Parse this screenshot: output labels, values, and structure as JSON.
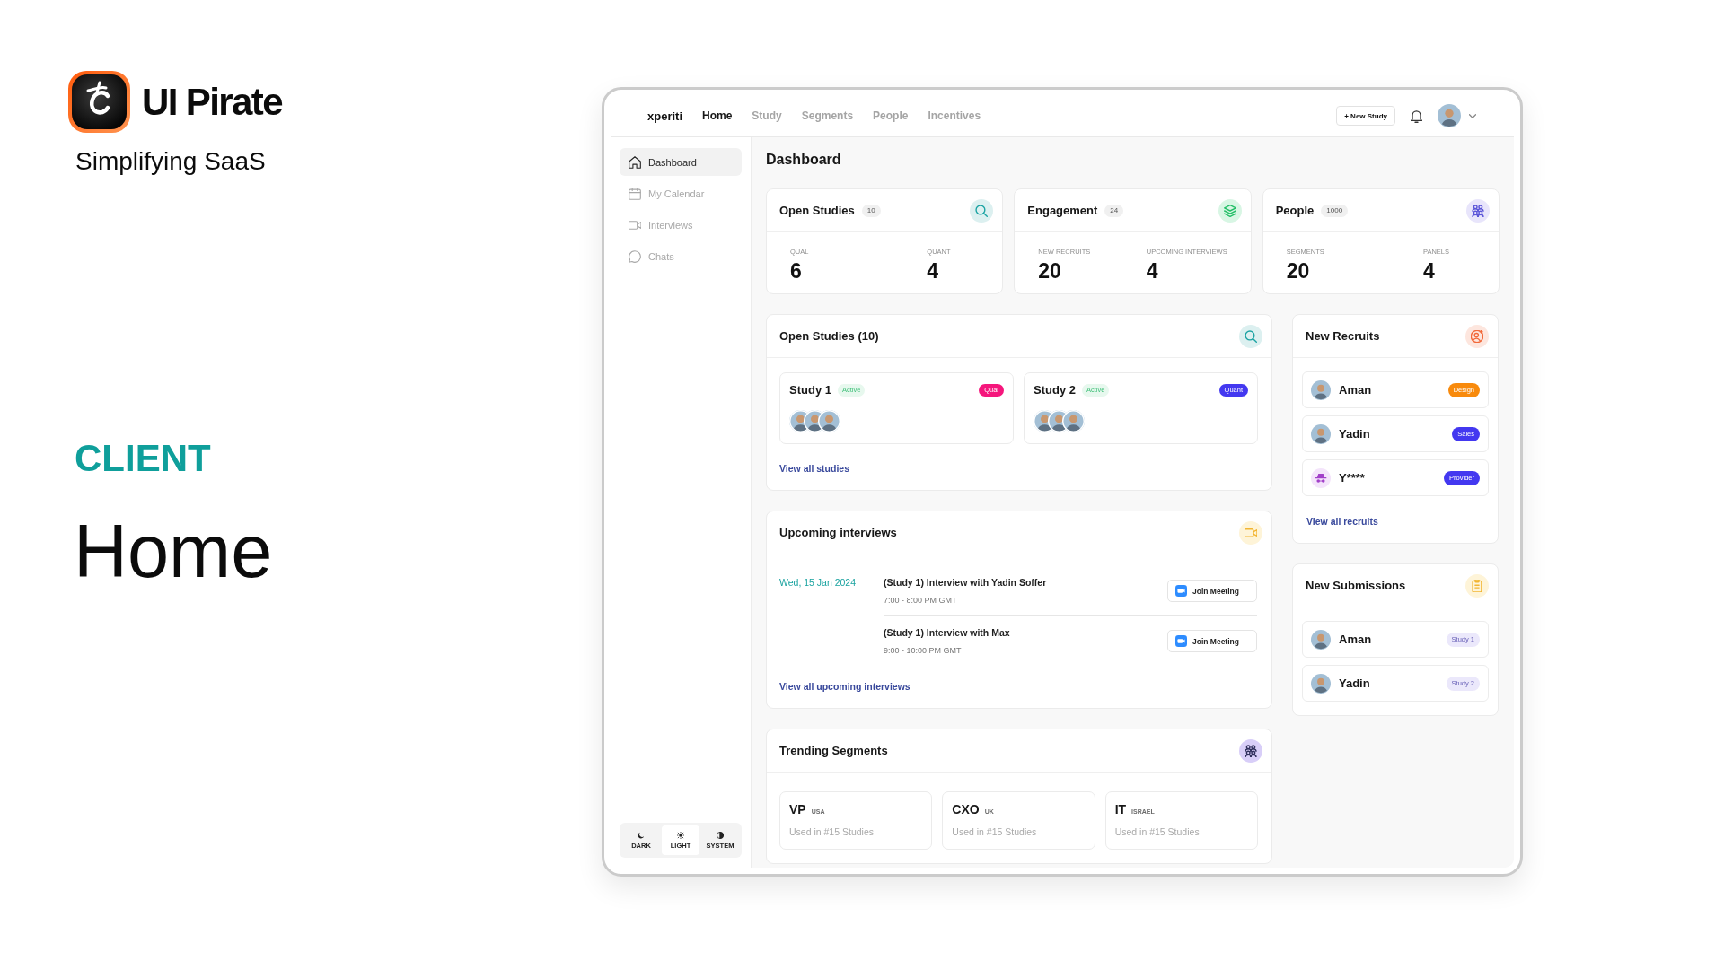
{
  "brand": {
    "name": "UI Pirate",
    "tagline": "Simplifying SaaS",
    "category": "CLIENT",
    "screen": "Home"
  },
  "topbar": {
    "logo": "xperiti",
    "nav": [
      {
        "label": "Home",
        "selected": true
      },
      {
        "label": "Study",
        "selected": false
      },
      {
        "label": "Segments",
        "selected": false
      },
      {
        "label": "People",
        "selected": false
      },
      {
        "label": "Incentives",
        "selected": false
      }
    ],
    "new_button": "+ New Study"
  },
  "sidebar": {
    "items": [
      {
        "label": "Dashboard",
        "kind": "dashboard",
        "selected": true
      },
      {
        "label": "My Calendar",
        "kind": "calendar",
        "selected": false
      },
      {
        "label": "Interviews",
        "kind": "interviews",
        "selected": false
      },
      {
        "label": "Chats",
        "kind": "chats",
        "selected": false
      }
    ],
    "theme": [
      {
        "label": "DARK",
        "kind": "dark",
        "selected": false
      },
      {
        "label": "LIGHT",
        "kind": "light",
        "selected": true
      },
      {
        "label": "SYSTEM",
        "kind": "system",
        "selected": false
      }
    ]
  },
  "page_title": "Dashboard",
  "stats": [
    {
      "kind": "studies",
      "title": "Open Studies",
      "count": "10",
      "metrics": [
        {
          "label": "QUAL",
          "value": "6"
        },
        {
          "label": "QUANT",
          "value": "4"
        }
      ]
    },
    {
      "kind": "engagement",
      "title": "Engagement",
      "count": "24",
      "metrics": [
        {
          "label": "NEW RECRUITS",
          "value": "20"
        },
        {
          "label": "UPCOMING INTERVIEWS",
          "value": "4"
        }
      ]
    },
    {
      "kind": "people",
      "title": "People",
      "count": "1000",
      "metrics": [
        {
          "label": "SEGMENTS",
          "value": "20"
        },
        {
          "label": "PANELS",
          "value": "4"
        }
      ]
    }
  ],
  "open_studies": {
    "title": "Open Studies (10)",
    "studies": [
      {
        "name": "Study 1",
        "status": "Active",
        "tag": {
          "label": "Qual",
          "color": "#f5167c"
        }
      },
      {
        "name": "Study 2",
        "status": "Active",
        "tag": {
          "label": "Quant",
          "color": "#4338f0"
        }
      }
    ],
    "link": "View all studies"
  },
  "upcoming_interviews": {
    "title": "Upcoming interviews",
    "days": [
      {
        "date": "Wed, 15 Jan 2024",
        "interviews": [
          {
            "title": "(Study 1) Interview with Yadin Soffer",
            "time": "7:00 - 8:00 PM GMT",
            "button": "Join Meeting"
          },
          {
            "title": "(Study 1) Interview with Max",
            "time": "9:00 - 10:00 PM GMT",
            "button": "Join Meeting"
          }
        ]
      }
    ],
    "link": "View all upcoming interviews"
  },
  "trending_segments": {
    "title": "Trending Segments",
    "segments": [
      {
        "name": "VP",
        "region": "USA",
        "usage": "Used in #15 Studies"
      },
      {
        "name": "CXO",
        "region": "UK",
        "usage": "Used in #15 Studies"
      },
      {
        "name": "IT",
        "region": "ISRAEL",
        "usage": "Used in #15 Studies"
      }
    ]
  },
  "new_recruits": {
    "title": "New Recruits",
    "recruits": [
      {
        "name": "Aman",
        "kind": "person",
        "tag": {
          "label": "Design",
          "color": "#f88a0c"
        }
      },
      {
        "name": "Yadin",
        "kind": "person",
        "tag": {
          "label": "Sales",
          "color": "#4338f0"
        }
      },
      {
        "name": "Y****",
        "kind": "anonymous",
        "tag": {
          "label": "Provider",
          "color": "#4338f0"
        }
      }
    ],
    "link": "View all recruits"
  },
  "new_submissions": {
    "title": "New Submissions",
    "submissions": [
      {
        "name": "Aman",
        "study": "Study 1"
      },
      {
        "name": "Yadin",
        "study": "Study 2"
      }
    ]
  }
}
